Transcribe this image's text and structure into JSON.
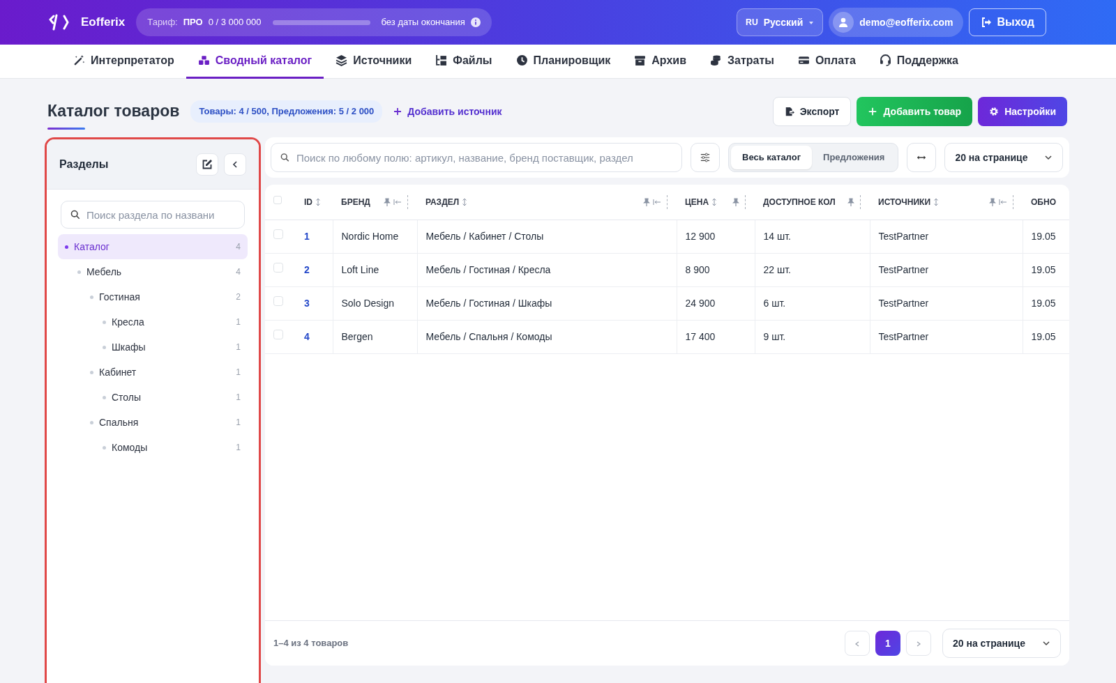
{
  "header": {
    "logo": "Eofferix",
    "plan": {
      "label": "Тариф:",
      "name": "ПРО",
      "usage": "0 / 3 000 000",
      "level": 0,
      "expiry": "без даты окончания"
    },
    "language": {
      "code": "RU",
      "name": "Русский"
    },
    "user": {
      "email": "demo@eofferix.com"
    },
    "logout": "Выход"
  },
  "nav": [
    {
      "label": "Интерпретатор",
      "selected": false
    },
    {
      "label": "Сводный каталог",
      "selected": true
    },
    {
      "label": "Источники",
      "selected": false
    },
    {
      "label": "Файлы",
      "selected": false
    },
    {
      "label": "Планировщик",
      "selected": false
    },
    {
      "label": "Архив",
      "selected": false
    },
    {
      "label": "Затраты",
      "selected": false
    },
    {
      "label": "Оплата",
      "selected": false
    },
    {
      "label": "Поддержка",
      "selected": false
    }
  ],
  "page": {
    "title": "Каталог товаров",
    "stats": "Товары: 4 / 500, Предложения: 5 / 2 000",
    "add_source": "Добавить источник",
    "buttons": [
      {
        "kind": "export",
        "label": "Экспорт"
      },
      {
        "kind": "add",
        "label": "Добавить товар"
      },
      {
        "kind": "settings",
        "label": "Настройки"
      }
    ]
  },
  "sidebar": {
    "title": "Разделы",
    "search": {
      "placeholder": "Поиск раздела по названи"
    },
    "tree": [
      {
        "label": "Каталог",
        "count": "4",
        "selected": true,
        "children": [
          {
            "label": "Мебель",
            "count": "4",
            "selected": false,
            "children": [
              {
                "label": "Гостиная",
                "count": "2",
                "selected": false,
                "children": [
                  {
                    "label": "Кресла",
                    "count": "1",
                    "selected": false
                  },
                  {
                    "label": "Шкафы",
                    "count": "1",
                    "selected": false
                  }
                ]
              },
              {
                "label": "Кабинет",
                "count": "1",
                "selected": false,
                "children": [
                  {
                    "label": "Столы",
                    "count": "1",
                    "selected": false
                  }
                ]
              },
              {
                "label": "Спальня",
                "count": "1",
                "selected": false,
                "children": [
                  {
                    "label": "Комоды",
                    "count": "1",
                    "selected": false
                  }
                ]
              }
            ]
          }
        ]
      }
    ]
  },
  "toolbar": {
    "search": {
      "placeholder": "Поиск по любому полю: артикул, название, бренд поставщик, раздел"
    },
    "views": [
      {
        "label": "Весь каталог",
        "selected": true
      },
      {
        "label": "Предложения",
        "selected": false
      }
    ],
    "per_page": "20 на странице"
  },
  "table": {
    "select_all": {
      "checked": false
    },
    "columns": [
      {
        "label": "ID",
        "sortable": true,
        "pinnable": false,
        "collapsible": false
      },
      {
        "label": "БРЕНД",
        "sortable": false,
        "pinnable": true,
        "collapsible": true
      },
      {
        "label": "РАЗДЕЛ",
        "sortable": true,
        "pinnable": true,
        "collapsible": true
      },
      {
        "label": "ЦЕНА",
        "sortable": true,
        "pinnable": true,
        "collapsible": false
      },
      {
        "label": "ДОСТУПНОЕ КОЛ",
        "sortable": false,
        "pinnable": true,
        "collapsible": false
      },
      {
        "label": "ИСТОЧНИКИ",
        "sortable": true,
        "pinnable": true,
        "collapsible": true
      },
      {
        "label": "ОБНО",
        "sortable": false,
        "pinnable": false,
        "collapsible": false
      }
    ],
    "rows": [
      {
        "checked": false,
        "cells": [
          "1",
          "Nordic Home",
          "Мебель / Кабинет / Столы",
          "12 900",
          "14 шт.",
          "TestPartner",
          "19.05"
        ]
      },
      {
        "checked": false,
        "cells": [
          "2",
          "Loft Line",
          "Мебель / Гостиная / Кресла",
          "8 900",
          "22 шт.",
          "TestPartner",
          "19.05"
        ]
      },
      {
        "checked": false,
        "cells": [
          "3",
          "Solo Design",
          "Мебель / Гостиная / Шкафы",
          "24 900",
          "6 шт.",
          "TestPartner",
          "19.05"
        ]
      },
      {
        "checked": false,
        "cells": [
          "4",
          "Bergen",
          "Мебель / Спальня / Комоды",
          "17 400",
          "9 шт.",
          "TestPartner",
          "19.05"
        ]
      }
    ]
  },
  "footer": {
    "summary": "1–4 из 4 товаров",
    "pages": [
      {
        "label": "1",
        "selected": true
      }
    ],
    "per_page": "20 на странице"
  }
}
